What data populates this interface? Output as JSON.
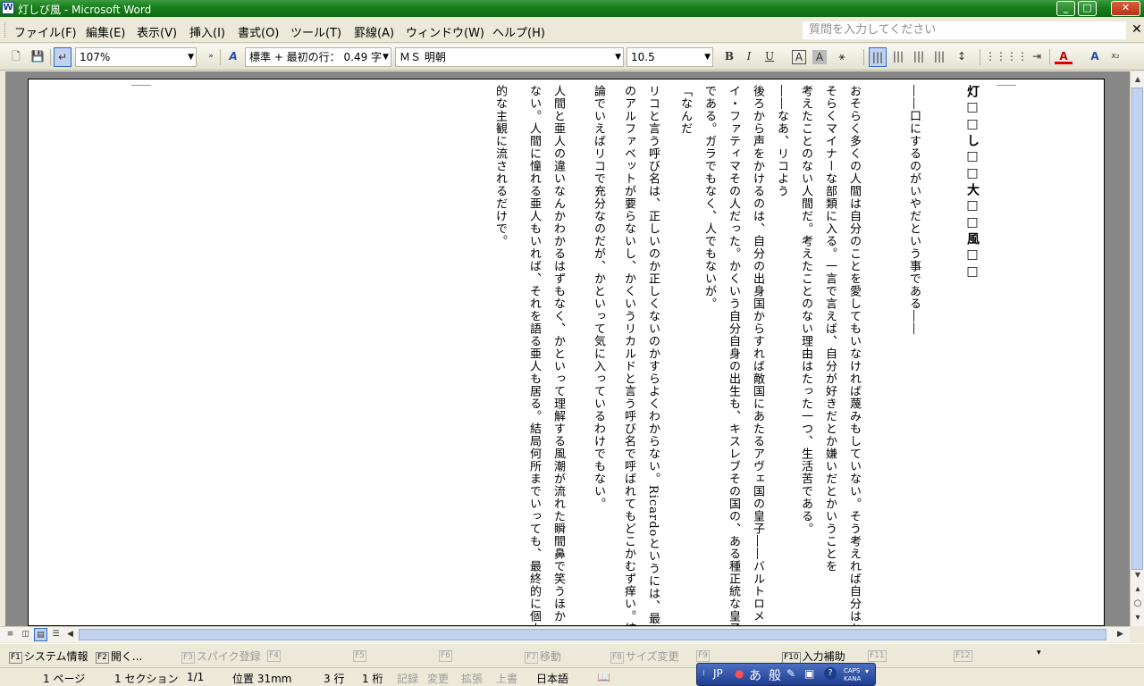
{
  "window": {
    "title": "灯しび風 - Microsoft Word",
    "app_icon": "W",
    "buttons": {
      "minimize": "_",
      "maximize": "□",
      "close": "✕"
    }
  },
  "menu": {
    "items": [
      "ファイル(F)",
      "編集(E)",
      "表示(V)",
      "挿入(I)",
      "書式(O)",
      "ツール(T)",
      "罫線(A)",
      "ウィンドウ(W)",
      "ヘルプ(H)"
    ],
    "help_placeholder": "質問を入力してください",
    "help_close": "✕"
  },
  "toolbar": {
    "zoom": "107%",
    "style": "標準 + 最初の行： 0.49 字",
    "font": "ＭＳ 明朝",
    "size": "10.5",
    "bold": "B",
    "italic": "I",
    "underline": "U",
    "char_border": "A",
    "char_shade": "A"
  },
  "document": {
    "columns": [
      "灯□□し□□大□□風□□",
      "",
      "――口にするのがいやだという事である――",
      "",
      "おそらく多くの人間は自分のことを愛してもいなければ蔑みもしていない。そう考えれば自分はお",
      "そらくマイナーな部類に入る。一言で言えば、自分が好きだとか嫌いだとかいうことを",
      "考えたことのない人間だ。考えたことのない理由はたった一つ、生活苦である。",
      "――なあ、リコよう",
      "後ろから声をかけるのは、自分の出身国からすれば敵国にあたるアヴェ国の皇子――バルトロメ",
      "イ・ファティマその人だった。かくいう自分自身の出生も、キスレブその国の、ある種正統な皇子",
      "である。ガラでもなく、人でもないが。",
      "「なんだ",
      "リコと言う呼び名は、正しいのか正しくないのかすらよくわからない。Ricardoというには、最後",
      "のアルファベットが要らないし、かくいうリカルドと言う呼び名で呼ばれてもどこかむず痒い。結",
      "論でいえばリコで充分なのだが、かといって気に入っているわけでもない。",
      "人間と亜人の違いなんかわかるはずもなく、かといって理解する風潮が流れた瞬間鼻で笑うほか",
      "ない。人間に憧れる亜人もいれば、それを語る亜人も居る。結局何所までいっても、最終的に個人",
      "的な主観に流されるだけで。"
    ],
    "para_mark": "↵"
  },
  "function_keys": [
    {
      "key": "F1",
      "label": "システム情報",
      "enabled": true
    },
    {
      "key": "F2",
      "label": "開く...",
      "enabled": true
    },
    {
      "key": "F3",
      "label": "スパイク登録",
      "enabled": false
    },
    {
      "key": "F4",
      "label": "",
      "enabled": false
    },
    {
      "key": "F5",
      "label": "",
      "enabled": false
    },
    {
      "key": "F6",
      "label": "",
      "enabled": false
    },
    {
      "key": "F7",
      "label": "移動",
      "enabled": false
    },
    {
      "key": "F8",
      "label": "サイズ変更",
      "enabled": false
    },
    {
      "key": "F9",
      "label": "",
      "enabled": false
    },
    {
      "key": "F10",
      "label": "入力補助",
      "enabled": true
    },
    {
      "key": "F11",
      "label": "",
      "enabled": false
    },
    {
      "key": "F12",
      "label": "",
      "enabled": false
    }
  ],
  "status": {
    "page": "1 ページ",
    "section": "1 セクション",
    "page_of": "1/1",
    "position": "位置 31mm",
    "line": "3 行",
    "column": "1 桁",
    "rec": "記録",
    "trk": "変更",
    "ext": "拡張",
    "ovr": "上書",
    "language": "日本語"
  },
  "ime": {
    "lang": "JP",
    "mode": "あ",
    "conv": "般",
    "caps": "CAPS",
    "kana": "KANA",
    "help": "?"
  }
}
